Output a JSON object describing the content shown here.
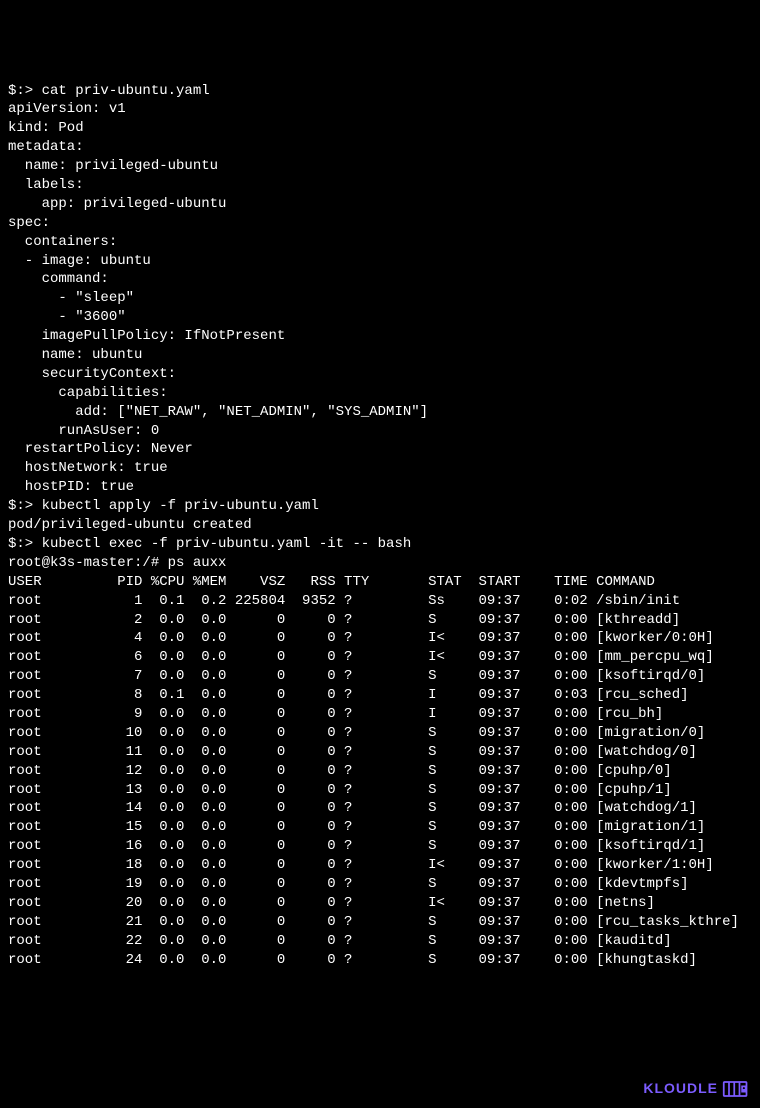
{
  "lines": [
    "$:> cat priv-ubuntu.yaml",
    "apiVersion: v1",
    "kind: Pod",
    "metadata:",
    "  name: privileged-ubuntu",
    "  labels:",
    "    app: privileged-ubuntu",
    "spec:",
    "  containers:",
    "  - image: ubuntu",
    "    command:",
    "      - \"sleep\"",
    "      - \"3600\"",
    "    imagePullPolicy: IfNotPresent",
    "    name: ubuntu",
    "    securityContext:",
    "      capabilities:",
    "        add: [\"NET_RAW\", \"NET_ADMIN\", \"SYS_ADMIN\"]",
    "      runAsUser: 0",
    "  restartPolicy: Never",
    "  hostNetwork: true",
    "  hostPID: true",
    "$:> kubectl apply -f priv-ubuntu.yaml",
    "pod/privileged-ubuntu created",
    "$:> kubectl exec -f priv-ubuntu.yaml -it -- bash",
    "root@k3s-master:/# ps auxx"
  ],
  "ps_header": [
    "USER",
    "PID",
    "%CPU",
    "%MEM",
    "VSZ",
    "RSS",
    "TTY",
    "STAT",
    "START",
    "TIME",
    "COMMAND"
  ],
  "ps_rows": [
    [
      "root",
      "1",
      "0.1",
      "0.2",
      "225804",
      "9352",
      "?",
      "Ss",
      "09:37",
      "0:02",
      "/sbin/init"
    ],
    [
      "root",
      "2",
      "0.0",
      "0.0",
      "0",
      "0",
      "?",
      "S",
      "09:37",
      "0:00",
      "[kthreadd]"
    ],
    [
      "root",
      "4",
      "0.0",
      "0.0",
      "0",
      "0",
      "?",
      "I<",
      "09:37",
      "0:00",
      "[kworker/0:0H]"
    ],
    [
      "root",
      "6",
      "0.0",
      "0.0",
      "0",
      "0",
      "?",
      "I<",
      "09:37",
      "0:00",
      "[mm_percpu_wq]"
    ],
    [
      "root",
      "7",
      "0.0",
      "0.0",
      "0",
      "0",
      "?",
      "S",
      "09:37",
      "0:00",
      "[ksoftirqd/0]"
    ],
    [
      "root",
      "8",
      "0.1",
      "0.0",
      "0",
      "0",
      "?",
      "I",
      "09:37",
      "0:03",
      "[rcu_sched]"
    ],
    [
      "root",
      "9",
      "0.0",
      "0.0",
      "0",
      "0",
      "?",
      "I",
      "09:37",
      "0:00",
      "[rcu_bh]"
    ],
    [
      "root",
      "10",
      "0.0",
      "0.0",
      "0",
      "0",
      "?",
      "S",
      "09:37",
      "0:00",
      "[migration/0]"
    ],
    [
      "root",
      "11",
      "0.0",
      "0.0",
      "0",
      "0",
      "?",
      "S",
      "09:37",
      "0:00",
      "[watchdog/0]"
    ],
    [
      "root",
      "12",
      "0.0",
      "0.0",
      "0",
      "0",
      "?",
      "S",
      "09:37",
      "0:00",
      "[cpuhp/0]"
    ],
    [
      "root",
      "13",
      "0.0",
      "0.0",
      "0",
      "0",
      "?",
      "S",
      "09:37",
      "0:00",
      "[cpuhp/1]"
    ],
    [
      "root",
      "14",
      "0.0",
      "0.0",
      "0",
      "0",
      "?",
      "S",
      "09:37",
      "0:00",
      "[watchdog/1]"
    ],
    [
      "root",
      "15",
      "0.0",
      "0.0",
      "0",
      "0",
      "?",
      "S",
      "09:37",
      "0:00",
      "[migration/1]"
    ],
    [
      "root",
      "16",
      "0.0",
      "0.0",
      "0",
      "0",
      "?",
      "S",
      "09:37",
      "0:00",
      "[ksoftirqd/1]"
    ],
    [
      "root",
      "18",
      "0.0",
      "0.0",
      "0",
      "0",
      "?",
      "I<",
      "09:37",
      "0:00",
      "[kworker/1:0H]"
    ],
    [
      "root",
      "19",
      "0.0",
      "0.0",
      "0",
      "0",
      "?",
      "S",
      "09:37",
      "0:00",
      "[kdevtmpfs]"
    ],
    [
      "root",
      "20",
      "0.0",
      "0.0",
      "0",
      "0",
      "?",
      "I<",
      "09:37",
      "0:00",
      "[netns]"
    ],
    [
      "root",
      "21",
      "0.0",
      "0.0",
      "0",
      "0",
      "?",
      "S",
      "09:37",
      "0:00",
      "[rcu_tasks_kthre]"
    ],
    [
      "root",
      "22",
      "0.0",
      "0.0",
      "0",
      "0",
      "?",
      "S",
      "09:37",
      "0:00",
      "[kauditd]"
    ],
    [
      "root",
      "24",
      "0.0",
      "0.0",
      "0",
      "0",
      "?",
      "S",
      "09:37",
      "0:00",
      "[khungtaskd]"
    ]
  ],
  "brand": "KLOUDLE"
}
